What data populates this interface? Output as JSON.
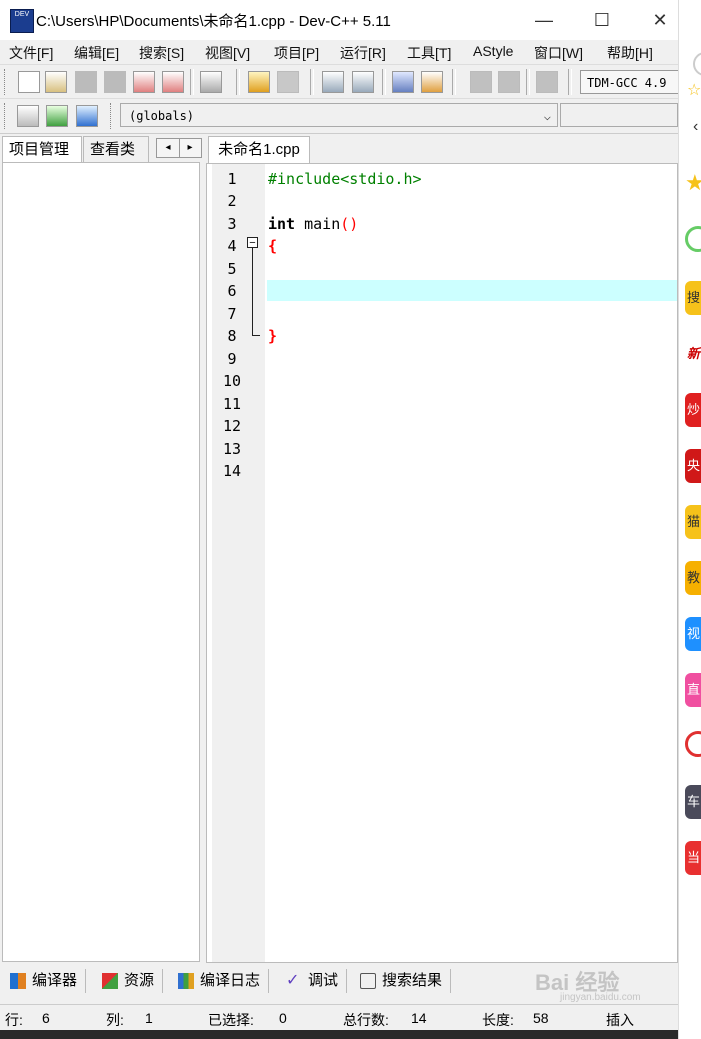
{
  "window": {
    "title": "C:\\Users\\HP\\Documents\\未命名1.cpp - Dev-C++ 5.11",
    "app_icon_text": "DEV",
    "minimize": "—",
    "maximize": "☐",
    "close": "✕"
  },
  "menu": [
    "文件[F]",
    "编辑[E]",
    "搜索[S]",
    "视图[V]",
    "项目[P]",
    "运行[R]",
    "工具[T]",
    "AStyle",
    "窗口[W]",
    "帮助[H]"
  ],
  "toolbar": {
    "compiler": "TDM-GCC 4.9",
    "scope": "(globals)",
    "scope_arrow": "⌵"
  },
  "left_panel": {
    "tabs": [
      "项目管理",
      "查看类"
    ],
    "scroll_left": "◂",
    "scroll_right": "▸"
  },
  "editor": {
    "tab": "未命名1.cpp",
    "fold_symbol": "−",
    "line_numbers": [
      "1",
      "2",
      "3",
      "4",
      "5",
      "6",
      "7",
      "8",
      "9",
      "10",
      "11",
      "12",
      "13",
      "14"
    ],
    "code": {
      "line1": "#include<stdio.h>",
      "line3_kw": "int",
      "line3_rest": " main",
      "line3_paren": "()",
      "line4": "{",
      "line8": "}"
    }
  },
  "bottom_tabs": [
    "编译器",
    "资源",
    "编译日志",
    "调试",
    "搜索结果"
  ],
  "status": {
    "row_label": "行:",
    "row_value": "6",
    "col_label": "列:",
    "col_value": "1",
    "sel_label": "已选择:",
    "sel_value": "0",
    "lines_label": "总行数:",
    "lines_value": "14",
    "len_label": "长度:",
    "len_value": "58",
    "mode": "插入"
  },
  "right_panel": {
    "items": [
      "搜",
      "新",
      "炒",
      "央",
      "猫",
      "教",
      "视",
      "直",
      "车",
      "当"
    ],
    "colors": [
      "#f6c21a",
      "#222222",
      "#e02020",
      "#d01818",
      "#f6c21a",
      "#f6b000",
      "#1e90ff",
      "#f04fa0",
      "#4a4a5a",
      "#e83030"
    ]
  },
  "watermark": {
    "text": "Bai 经验",
    "sub": "jingyan.baidu.com"
  }
}
